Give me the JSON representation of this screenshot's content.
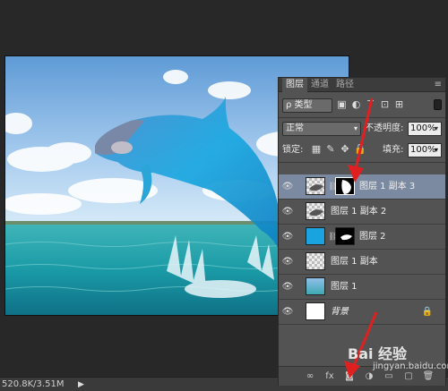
{
  "status_bar": {
    "doc_size": "520.8K/3.51M",
    "arrow": "▶"
  },
  "layers_panel": {
    "tabs": [
      "图层",
      "通道",
      "路径"
    ],
    "filter": {
      "kind_label": "ρ 类型",
      "icons": [
        "image-filter-icon",
        "adjustment-filter-icon",
        "type-filter-icon",
        "shape-filter-icon",
        "smart-object-filter-icon"
      ]
    },
    "blend_mode": "正常",
    "opacity_label": "不透明度:",
    "opacity_value": "100%",
    "lock_label": "锁定:",
    "fill_label": "填充:",
    "fill_value": "100%",
    "layers": [
      {
        "name": "图层 1 副本 3",
        "selected": true,
        "has_mask": true
      },
      {
        "name": "图层 1 副本 2",
        "selected": false,
        "has_mask": false
      },
      {
        "name": "图层 2",
        "selected": false,
        "has_mask": true
      },
      {
        "name": "图层 1 副本",
        "selected": false,
        "has_mask": false
      },
      {
        "name": "图层 1",
        "selected": false,
        "has_mask": false
      },
      {
        "name": "背景",
        "selected": false,
        "has_mask": false,
        "locked": true
      }
    ],
    "bottom_icons": [
      "link-layers-icon",
      "fx-icon",
      "add-mask-icon",
      "adjustment-layer-icon",
      "group-icon",
      "new-layer-icon",
      "trash-icon"
    ]
  },
  "watermark": {
    "brand": "Bai 经验",
    "sub": "jingyan.baidu.com"
  },
  "colors": {
    "arrow_red": "#e02020",
    "selected_layer": "#7b8aa0",
    "panel_bg": "#535353"
  }
}
